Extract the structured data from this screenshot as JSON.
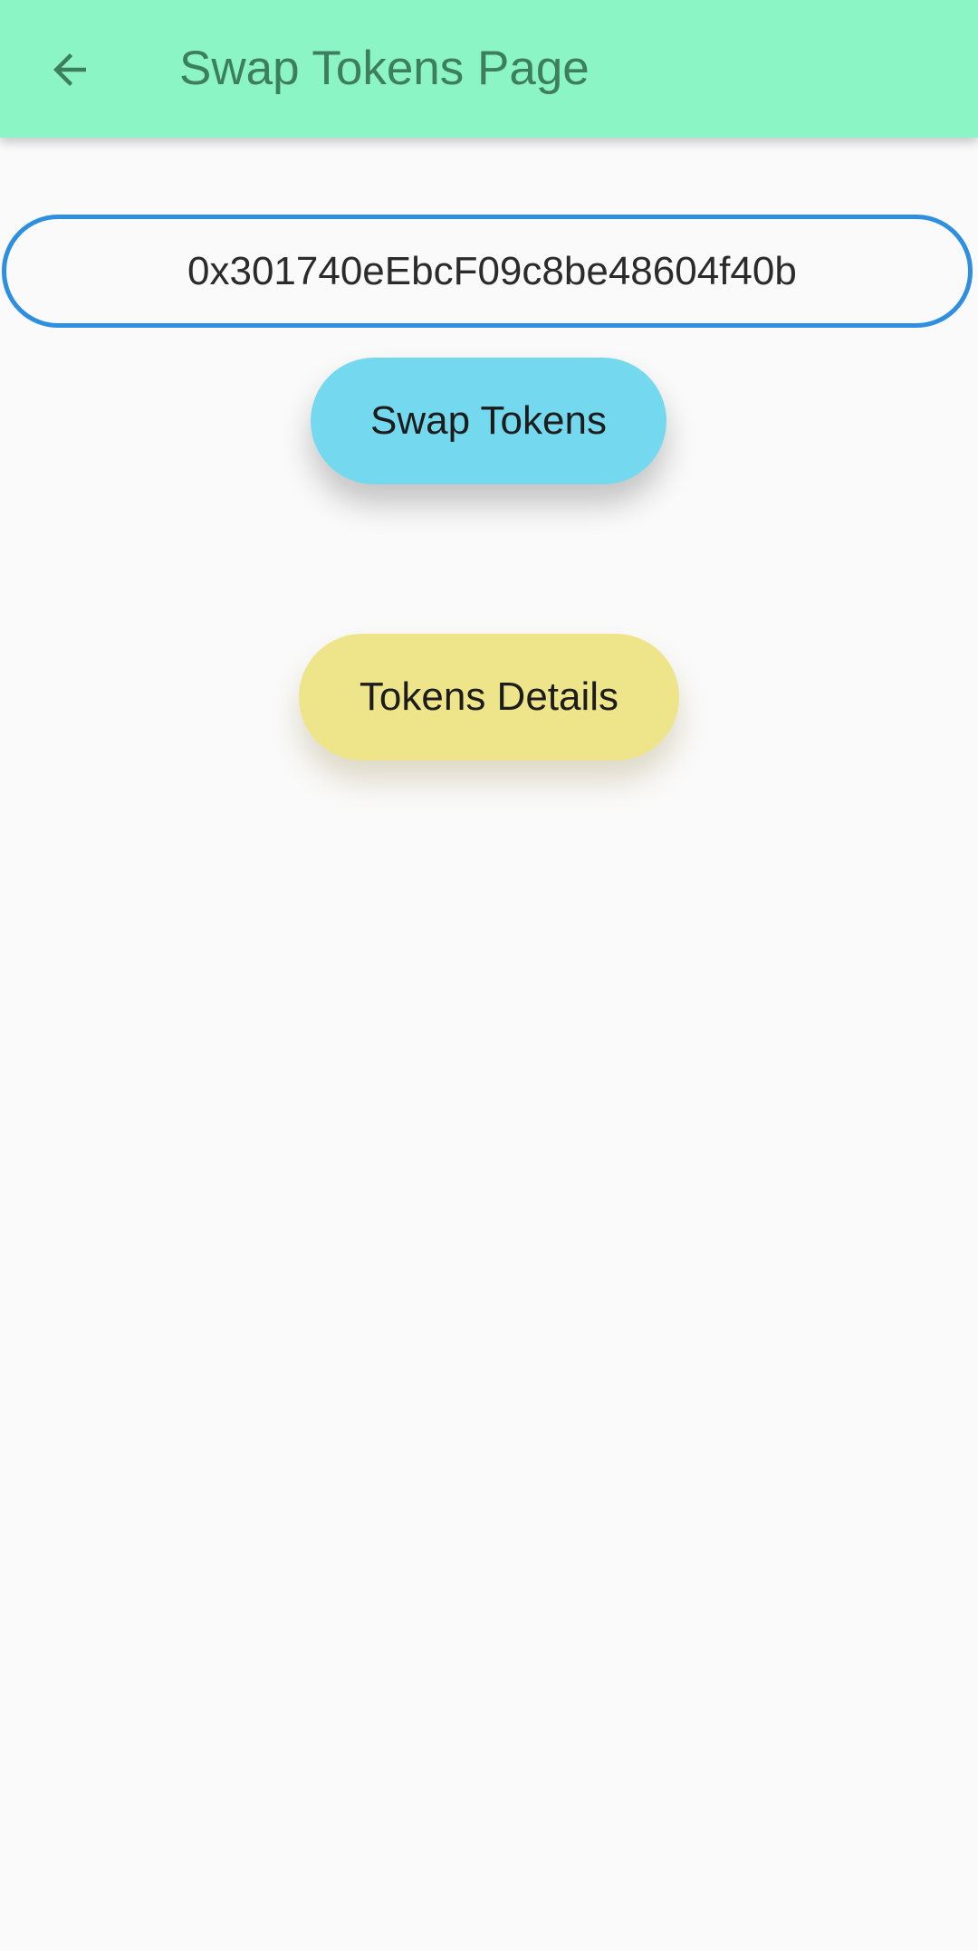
{
  "app_bar": {
    "title": "Swap Tokens Page",
    "back_icon": "arrow-back-icon",
    "background_color": "#8cf5c5",
    "title_color": "#3c7e5e"
  },
  "address_field": {
    "value": "0x301740eEbcF09c8be48604f40b",
    "border_color": "#2e8fe0"
  },
  "buttons": {
    "swap_label": "Swap Tokens",
    "swap_color": "#74d9ee",
    "details_label": "Tokens Details",
    "details_color": "#eee48a"
  }
}
